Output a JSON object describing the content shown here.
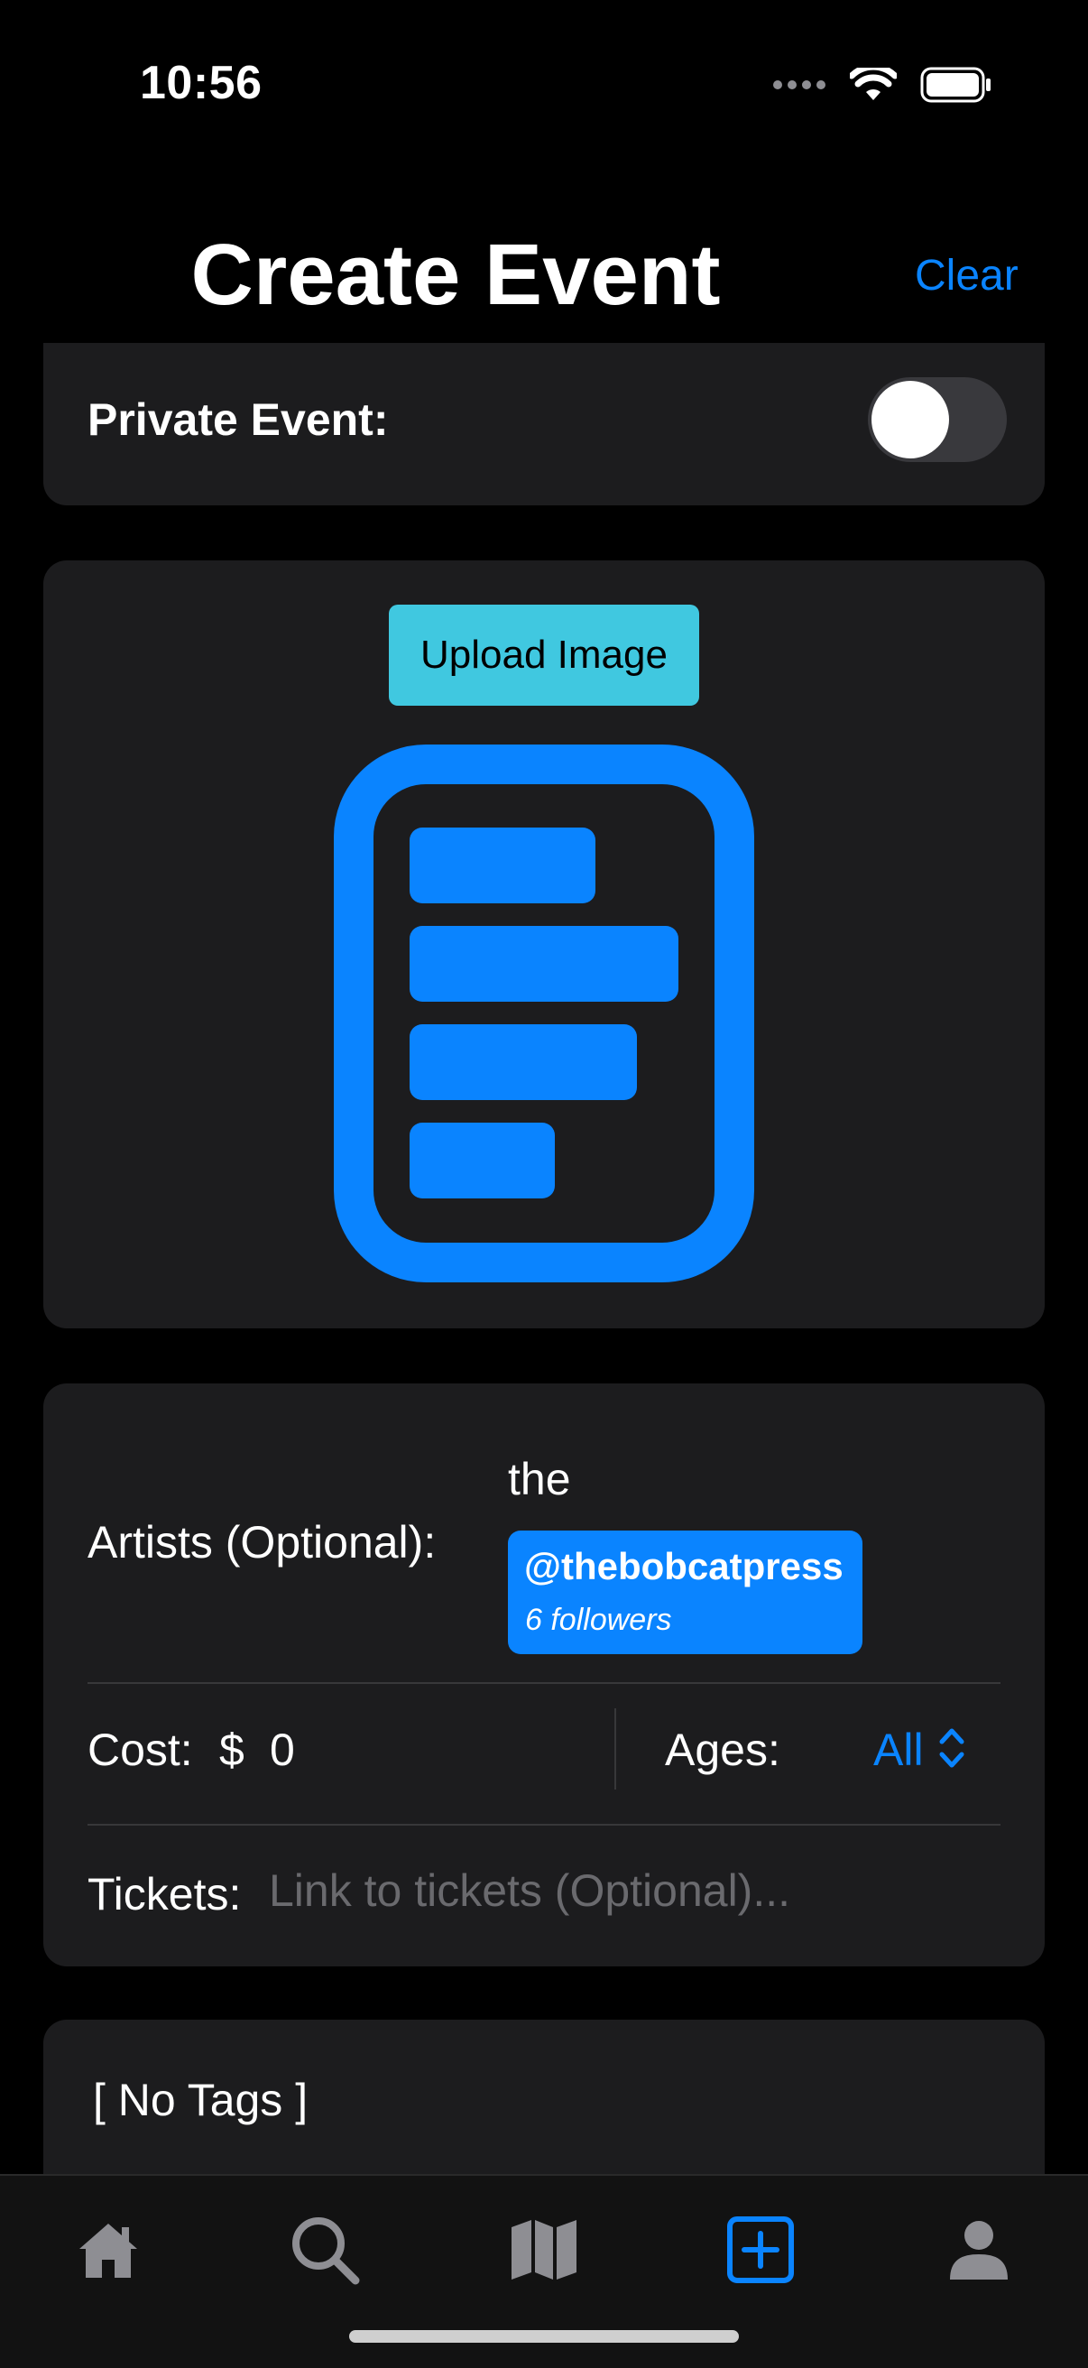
{
  "status_bar": {
    "time": "10:56"
  },
  "header": {
    "title": "Create Event",
    "clear_label": "Clear"
  },
  "private_event": {
    "label": "Private Event:",
    "enabled": false
  },
  "image_section": {
    "upload_label": "Upload Image",
    "icon": "text-document-icon"
  },
  "artists": {
    "label": "Artists (Optional):",
    "query": "the",
    "suggestion": {
      "handle": "@thebobcatpress",
      "followers": "6 followers"
    }
  },
  "cost": {
    "label": "Cost:",
    "currency": "$",
    "value": "0"
  },
  "ages": {
    "label": "Ages:",
    "value": "All"
  },
  "tickets": {
    "label": "Tickets:",
    "placeholder": "Link to tickets (Optional)..."
  },
  "tags": {
    "text": "[ No Tags ]"
  },
  "tab_bar": {
    "items": [
      "home-icon",
      "search-icon",
      "map-icon",
      "add-icon",
      "profile-icon"
    ],
    "active": "add-icon"
  },
  "colors": {
    "accent": "#0a84ff",
    "upload_button": "#40c8e0",
    "card": "#1c1c1e",
    "background": "#000000"
  }
}
